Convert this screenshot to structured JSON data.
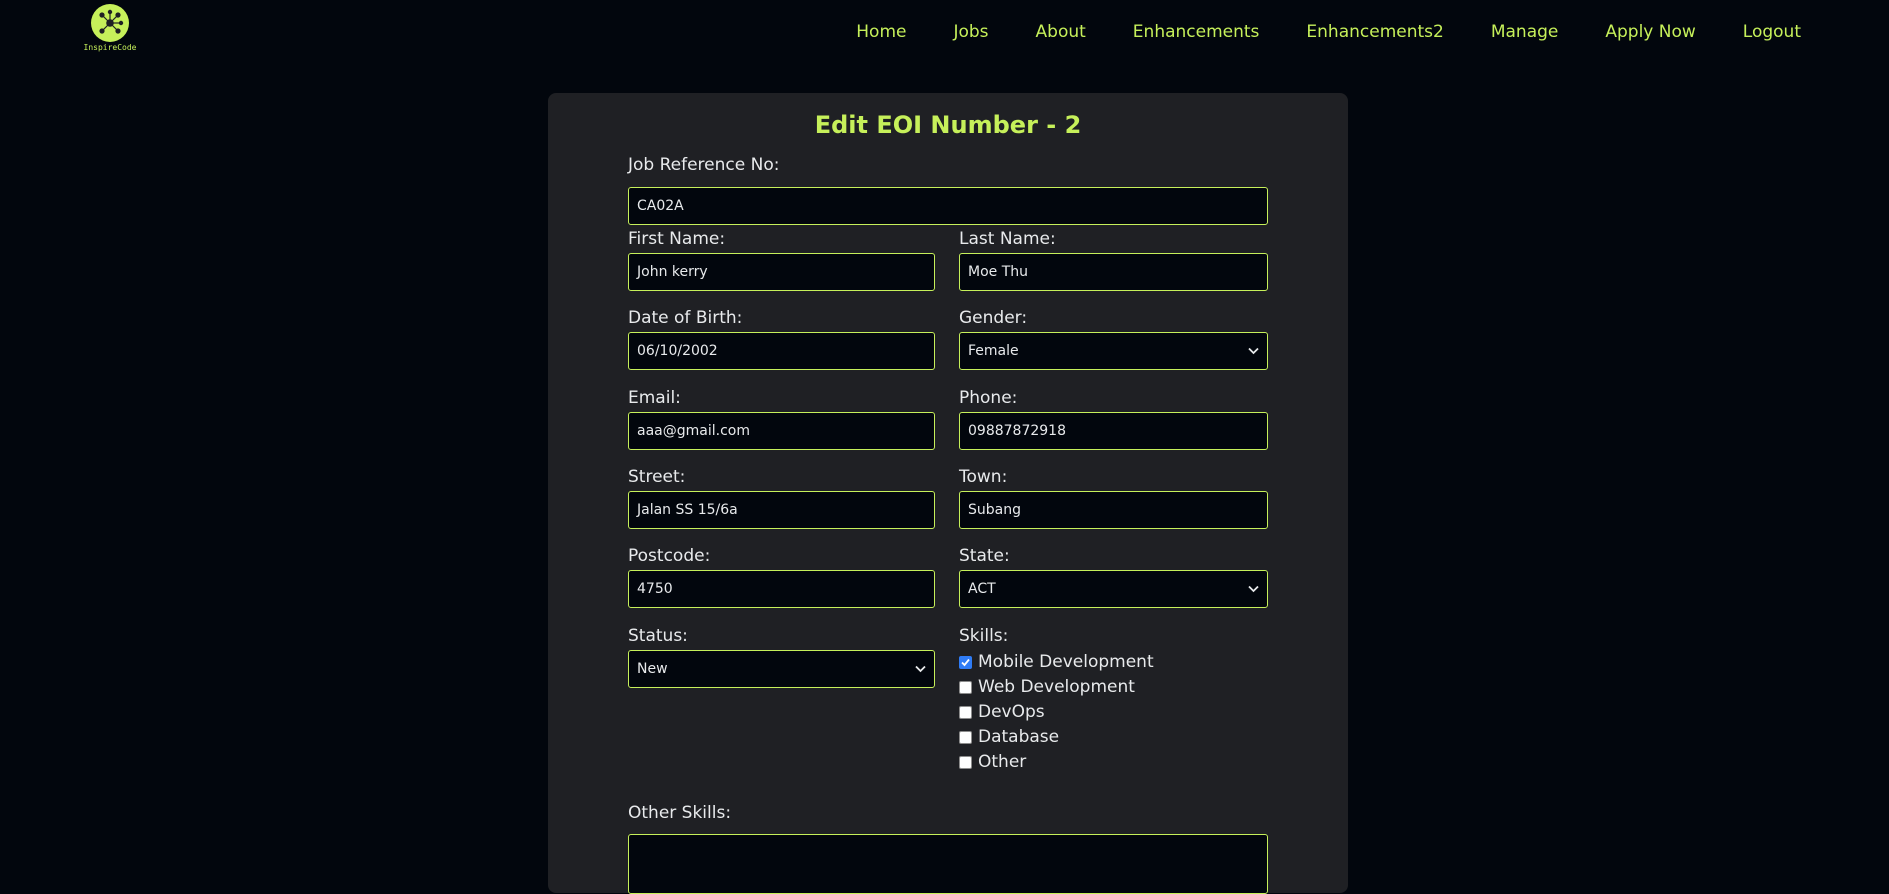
{
  "brand": {
    "name": "InspireCode"
  },
  "nav": {
    "items": [
      "Home",
      "Jobs",
      "About",
      "Enhancements",
      "Enhancements2",
      "Manage",
      "Apply Now",
      "Logout"
    ]
  },
  "form": {
    "title": "Edit EOI Number - 2",
    "job_ref": {
      "label": "Job Reference No:",
      "value": "CA02A"
    },
    "first_name": {
      "label": "First Name:",
      "value": "John kerry"
    },
    "last_name": {
      "label": "Last Name:",
      "value": "Moe Thu"
    },
    "dob": {
      "label": "Date of Birth:",
      "value": "06/10/2002"
    },
    "gender": {
      "label": "Gender:",
      "value": "Female"
    },
    "email": {
      "label": "Email:",
      "value": "aaa@gmail.com"
    },
    "phone": {
      "label": "Phone:",
      "value": "09887872918"
    },
    "street": {
      "label": "Street:",
      "value": "Jalan SS 15/6a"
    },
    "town": {
      "label": "Town:",
      "value": "Subang"
    },
    "postcode": {
      "label": "Postcode:",
      "value": "4750"
    },
    "state": {
      "label": "State:",
      "value": "ACT"
    },
    "status": {
      "label": "Status:",
      "value": "New"
    },
    "skills": {
      "label": "Skills:",
      "items": [
        {
          "label": "Mobile Development",
          "checked": true
        },
        {
          "label": "Web Development",
          "checked": false
        },
        {
          "label": "DevOps",
          "checked": false
        },
        {
          "label": "Database",
          "checked": false
        },
        {
          "label": "Other",
          "checked": false
        }
      ]
    },
    "other_skills": {
      "label": "Other Skills:",
      "value": ""
    }
  },
  "colors": {
    "accent": "#c6f05a",
    "background": "#02060d",
    "card": "#1f2024",
    "checkbox_checked": "#2f7cf6"
  },
  "icons": {
    "logo": "network-nodes-icon",
    "select_arrow": "chevron-down-icon",
    "check": "checkmark-icon"
  }
}
